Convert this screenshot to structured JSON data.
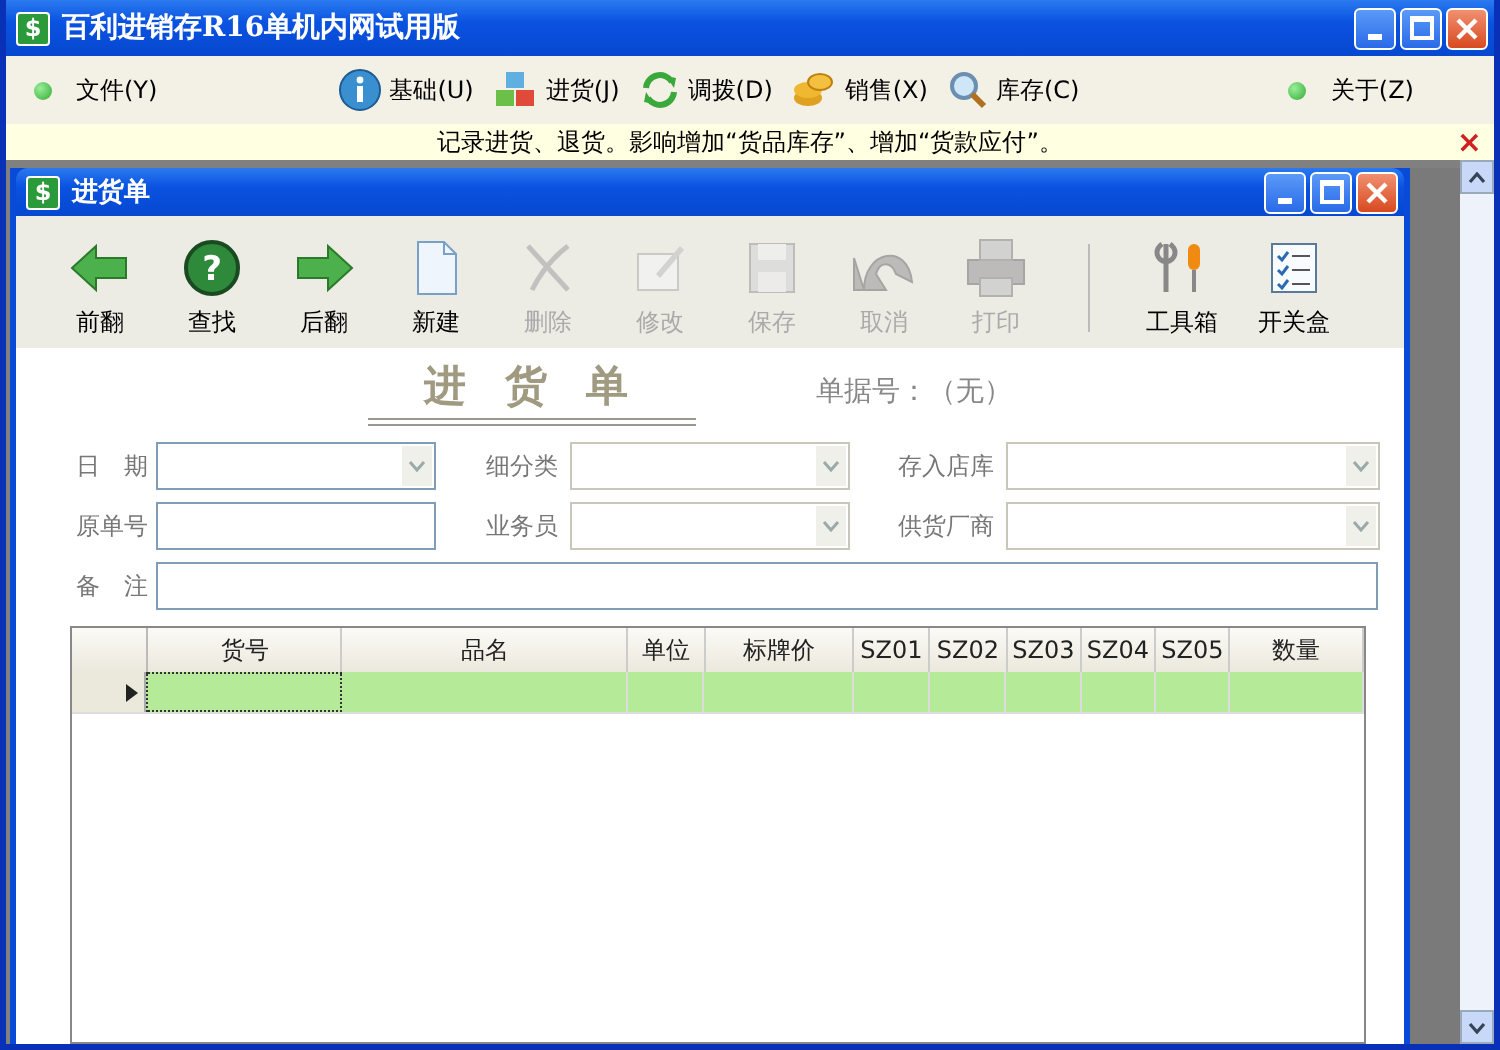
{
  "window": {
    "title": "百利进销存R16单机内网试用版",
    "icon_glyph": "$"
  },
  "menu": {
    "left": [
      {
        "label": "文件(Y)"
      }
    ],
    "middle": [
      {
        "label": "基础(U)"
      },
      {
        "label": "进货(J)"
      },
      {
        "label": "调拨(D)"
      },
      {
        "label": "销售(X)"
      },
      {
        "label": "库存(C)"
      }
    ],
    "right": [
      {
        "label": "关于(Z)"
      }
    ]
  },
  "info_bar": {
    "text": "记录进货、退货。影响增加“货品库存”、增加“货款应付”。",
    "close": "×"
  },
  "child_window": {
    "title": "进货单",
    "icon_glyph": "$"
  },
  "toolbar": [
    {
      "label": "前翻",
      "disabled": false
    },
    {
      "label": "查找",
      "disabled": false,
      "glyph": "?"
    },
    {
      "label": "后翻",
      "disabled": false
    },
    {
      "label": "新建",
      "disabled": false
    },
    {
      "label": "删除",
      "disabled": true
    },
    {
      "label": "修改",
      "disabled": true
    },
    {
      "label": "保存",
      "disabled": true
    },
    {
      "label": "取消",
      "disabled": true
    },
    {
      "label": "打印",
      "disabled": true
    },
    {
      "label": "工具箱",
      "disabled": false
    },
    {
      "label": "开关盒",
      "disabled": false
    }
  ],
  "form": {
    "title": "进 货 单",
    "number_label": "单据号：（无）",
    "rows": [
      [
        {
          "label": "日　期",
          "kind": "combo",
          "disabled": false
        },
        {
          "label": "细分类",
          "kind": "combo",
          "disabled": true
        },
        {
          "label": "存入店库",
          "kind": "combo",
          "disabled": true
        }
      ],
      [
        {
          "label": "原单号",
          "kind": "text",
          "disabled": false
        },
        {
          "label": "业务员",
          "kind": "combo",
          "disabled": true
        },
        {
          "label": "供货厂商",
          "kind": "combo",
          "disabled": true
        }
      ],
      [
        {
          "label": "备　注",
          "kind": "wide",
          "disabled": false
        }
      ]
    ]
  },
  "grid": {
    "columns": [
      "货号",
      "品名",
      "单位",
      "标牌价",
      "SZ01",
      "SZ02",
      "SZ03",
      "SZ04",
      "SZ05",
      "数量"
    ],
    "rows": [
      {
        "selected": true
      }
    ]
  }
}
